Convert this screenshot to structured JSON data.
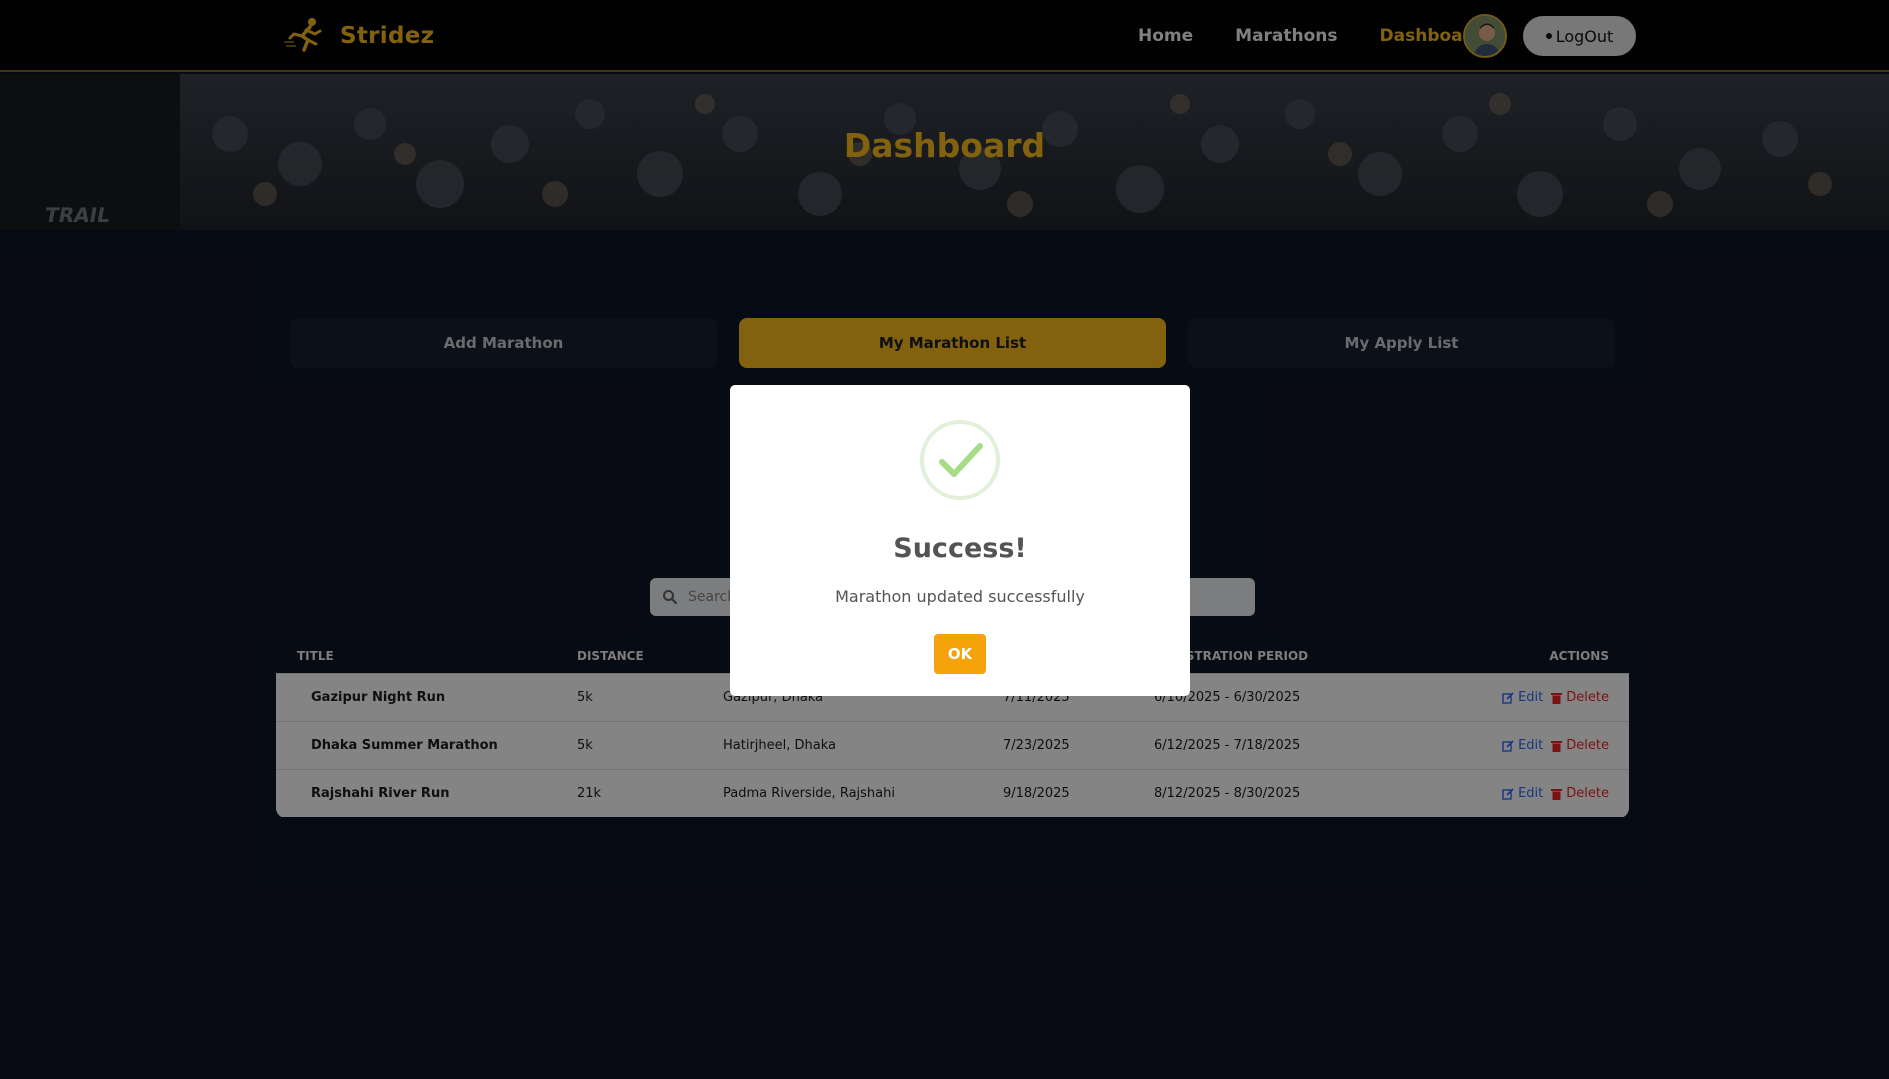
{
  "navbar": {
    "brand": "Stridez",
    "links": [
      "Home",
      "Marathons",
      "Dashboard"
    ],
    "active_link": "Dashboard",
    "logout_label": "LogOut"
  },
  "banner": {
    "title": "Dashboard"
  },
  "tabs": [
    "Add Marathon",
    "My Marathon List",
    "My Apply List"
  ],
  "active_tab": "My Marathon List",
  "search": {
    "placeholder": "Search"
  },
  "table": {
    "headers": [
      "TITLE",
      "DISTANCE",
      "",
      "",
      "REGISTRATION PERIOD",
      "ACTIONS"
    ],
    "rows": [
      {
        "title": "Gazipur Night Run",
        "distance": "5k",
        "location": "Gazipur, Dhaka",
        "date": "7/11/2025",
        "period": "6/10/2025 - 6/30/2025"
      },
      {
        "title": "Dhaka Summer Marathon",
        "distance": "5k",
        "location": "Hatirjheel, Dhaka",
        "date": "7/23/2025",
        "period": "6/12/2025 - 7/18/2025"
      },
      {
        "title": "Rajshahi River Run",
        "distance": "21k",
        "location": "Padma Riverside, Rajshahi",
        "date": "9/18/2025",
        "period": "8/12/2025 - 8/30/2025"
      }
    ],
    "edit_label": "Edit",
    "delete_label": "Delete"
  },
  "modal": {
    "title": "Success!",
    "message": "Marathon updated successfully",
    "ok_label": "OK"
  },
  "colors": {
    "accent": "#d9a31a",
    "background": "#0d1322",
    "success": "#a5dc86",
    "ok_button": "#f5a20b"
  }
}
